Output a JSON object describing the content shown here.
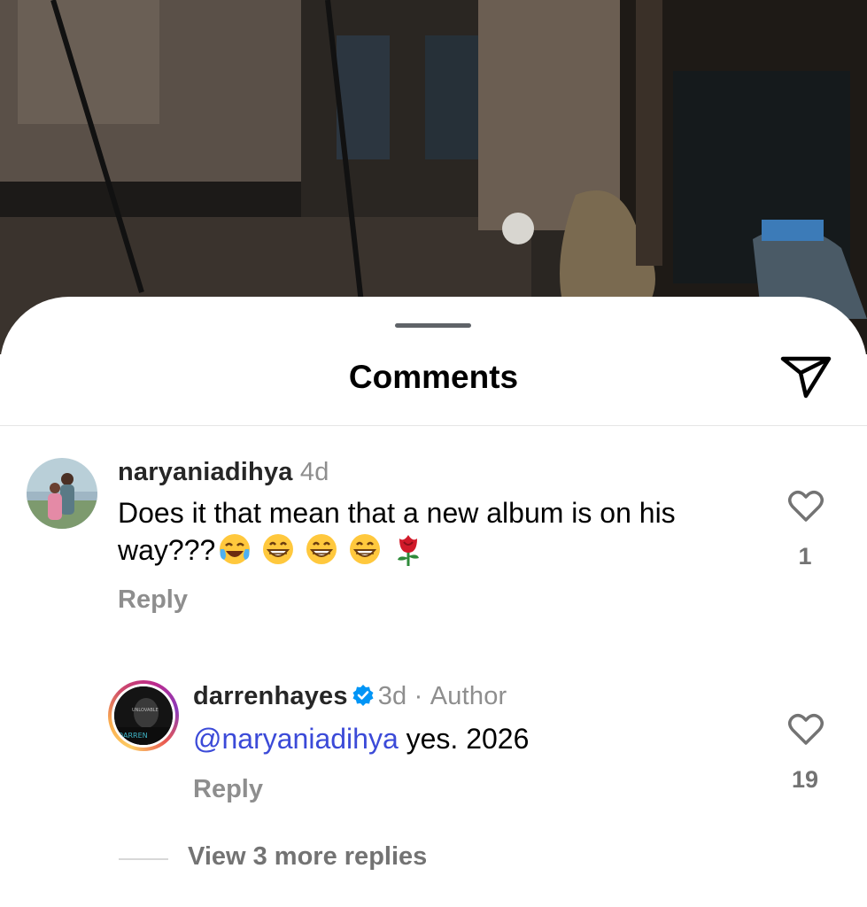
{
  "header": {
    "title": "Comments"
  },
  "comments": [
    {
      "username": "naryaniadihya",
      "time": "4d",
      "text": "Does it that mean that a new album is on his way???",
      "emojis": [
        "face-with-tears-of-joy-icon",
        "grinning-face-icon",
        "grinning-face-icon",
        "grinning-face-icon",
        "rose-icon"
      ],
      "reply_label": "Reply",
      "likes": "1"
    }
  ],
  "replies": [
    {
      "username": "darrenhayes",
      "time": "3d",
      "separator": "·",
      "author_label": "Author",
      "mention": "@naryaniadihya",
      "text": " yes. 2026",
      "reply_label": "Reply",
      "likes": "19",
      "avatar_text_top": "UNLOVABLE",
      "avatar_text_bottom": "DARREN"
    }
  ],
  "view_more": "View 3 more replies",
  "colors": {
    "mention": "#3b4ad8",
    "verified": "#0095f6",
    "muted": "#8e8e8e"
  }
}
